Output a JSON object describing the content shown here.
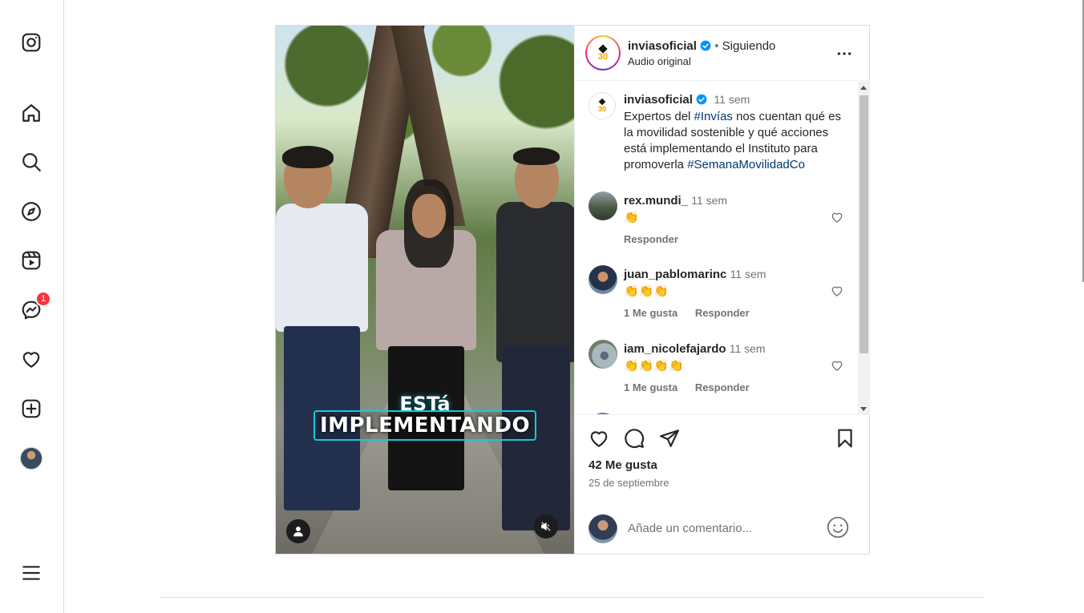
{
  "sidebar": {
    "messages_badge": "1"
  },
  "post": {
    "overlay_small": "ESTá",
    "overlay_big": "IMPLEMENTANDO",
    "header": {
      "username": "inviasoficial",
      "separator": "•",
      "follow_status": "Siguiendo",
      "audio": "Audio original"
    },
    "caption": {
      "username": "inviasoficial",
      "time": "11 sem",
      "text_1": "Expertos del ",
      "hashtag_1": "#Invías",
      "text_2": " nos cuentan qué es la movilidad sostenible y qué acciones está implementando el Instituto para promoverla ",
      "hashtag_2": "#SemanaMovilidadCo"
    },
    "comments": [
      {
        "username": "rex.mundi_",
        "time": "11 sem",
        "text": "👏",
        "likes": "",
        "reply": "Responder"
      },
      {
        "username": "juan_pablomarinc",
        "time": "11 sem",
        "text": "👏👏👏",
        "likes": "1 Me gusta",
        "reply": "Responder"
      },
      {
        "username": "iam_nicolefajardo",
        "time": "11 sem",
        "text": "👏👏👏👏",
        "likes": "1 Me gusta",
        "reply": "Responder"
      }
    ],
    "likes_count": "42 Me gusta",
    "date": "25 de septiembre",
    "comment_placeholder": "Añade un comentario..."
  },
  "colors": {
    "link": "#00376b",
    "muted": "#737373",
    "verified": "#0095f6",
    "badge": "#ff3040",
    "overlay_accent": "#17c9d8"
  }
}
